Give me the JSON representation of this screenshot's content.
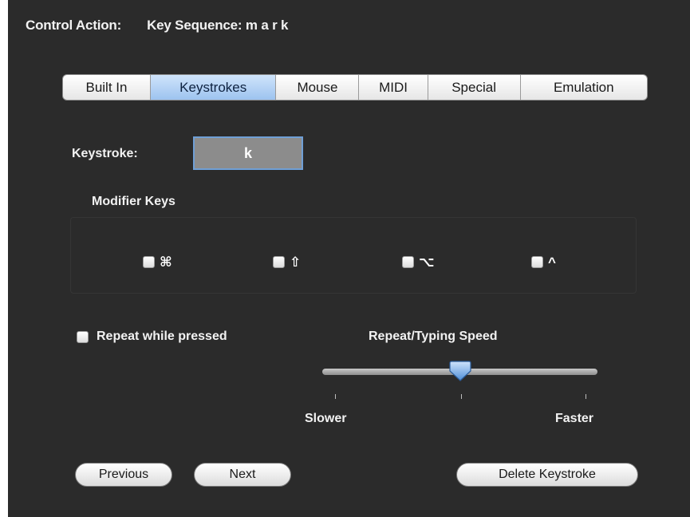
{
  "header": {
    "control_action": "Control Action:",
    "key_sequence": "Key Sequence: m a r k"
  },
  "tabs": [
    {
      "label": "Built In",
      "active": false
    },
    {
      "label": "Keystrokes",
      "active": true
    },
    {
      "label": "Mouse",
      "active": false
    },
    {
      "label": "MIDI",
      "active": false
    },
    {
      "label": "Special",
      "active": false
    },
    {
      "label": "Emulation",
      "active": false
    }
  ],
  "keystroke": {
    "label": "Keystroke:",
    "value": "k"
  },
  "modifiers": {
    "title": "Modifier Keys",
    "items": [
      {
        "glyph": "⌘",
        "icon": "command-icon",
        "checked": false
      },
      {
        "glyph": "⇧",
        "icon": "shift-icon",
        "checked": false
      },
      {
        "glyph": "⌥",
        "icon": "option-icon",
        "checked": false
      },
      {
        "glyph": "^",
        "icon": "control-icon",
        "checked": false
      }
    ]
  },
  "repeat": {
    "label": "Repeat while pressed",
    "checked": false
  },
  "speed": {
    "label": "Repeat/Typing Speed",
    "min_label": "Slower",
    "max_label": "Faster",
    "value": 0.5
  },
  "buttons": {
    "previous": "Previous",
    "next": "Next",
    "delete": "Delete Keystroke"
  },
  "colors": {
    "panel": "#2b2b2b",
    "active_tab": "#9dc3ef",
    "text": "#f2f2f2"
  }
}
